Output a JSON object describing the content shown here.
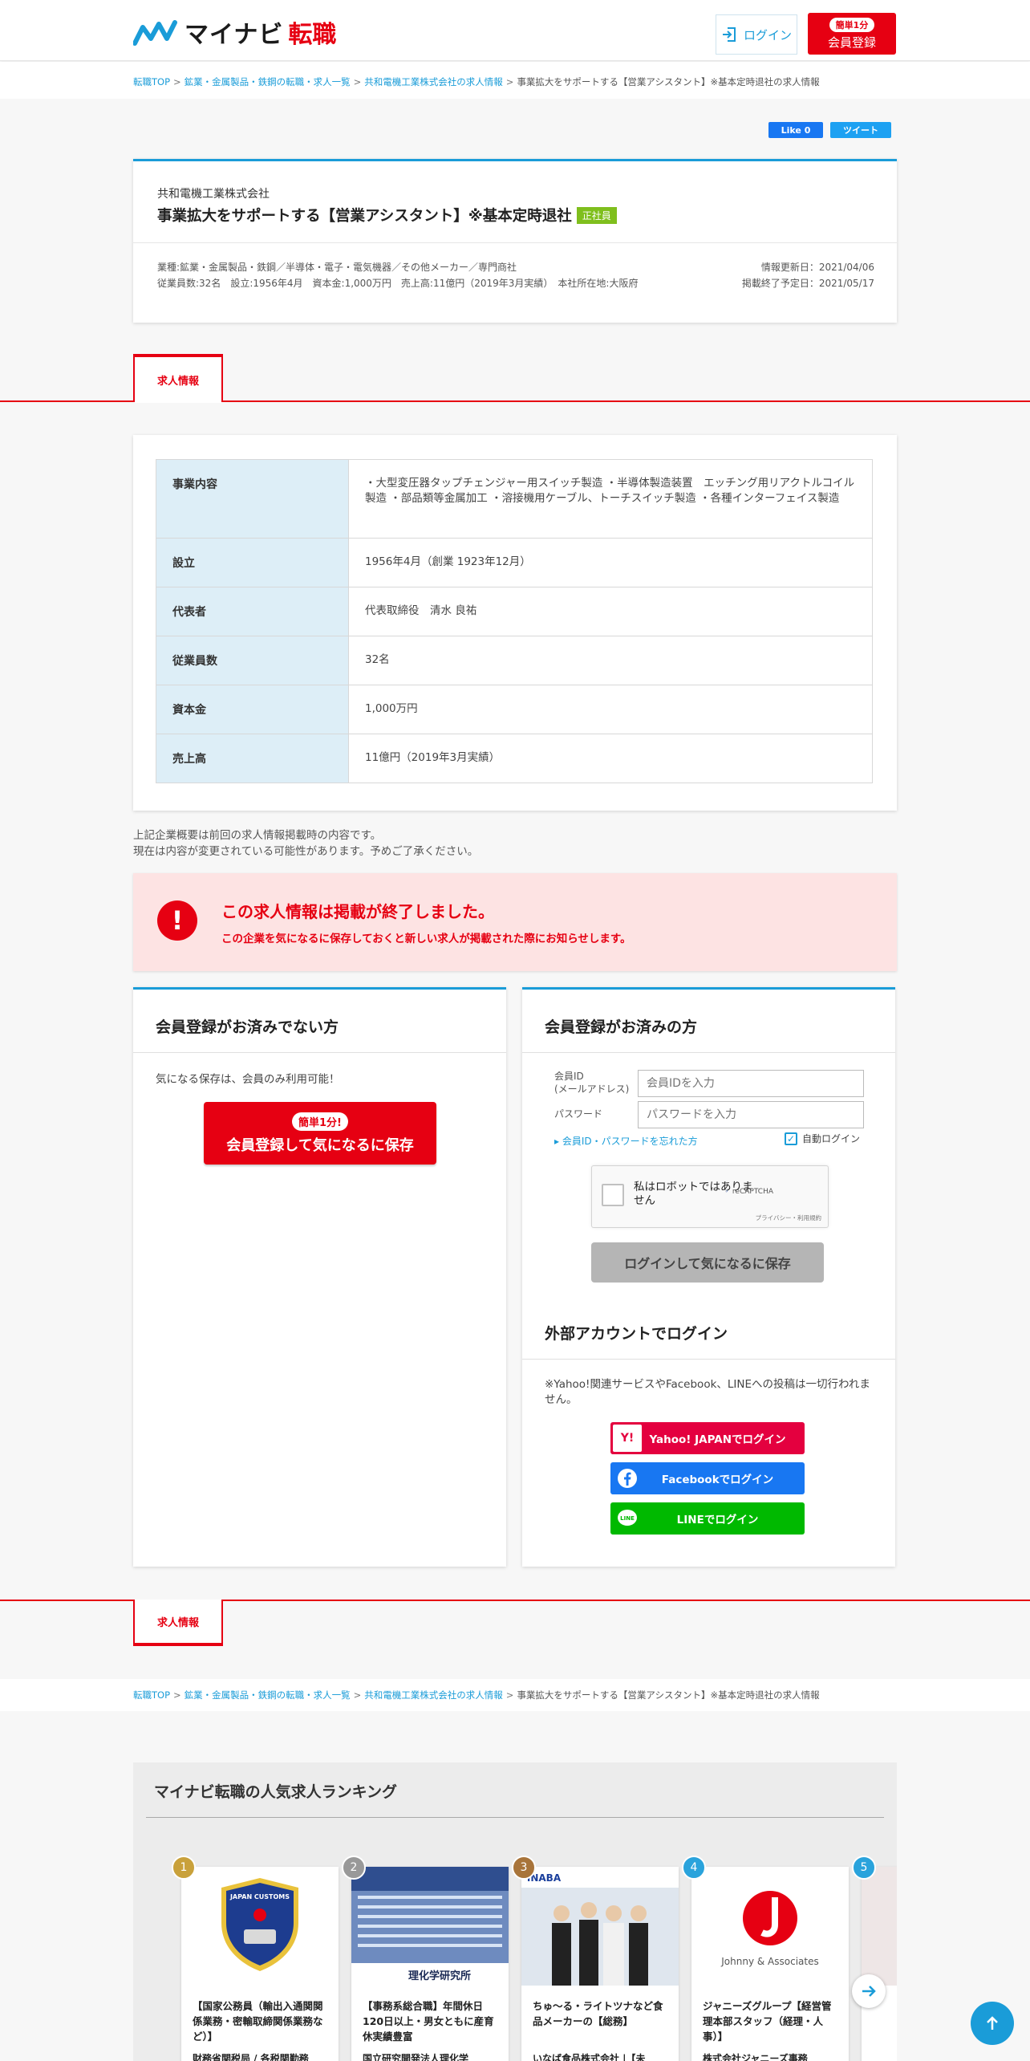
{
  "header": {
    "logo_text": "マイナビ",
    "logo_sub": "転職",
    "login_label": "ログイン",
    "register_pill": "簡単1分",
    "register_label": "会員登録"
  },
  "breadcrumb": {
    "items": [
      "転職TOP",
      "鉱業・金属製品・鉄鋼の転職・求人一覧",
      "共和電機工業株式会社の求人情報"
    ],
    "current": "事業拡大をサポートする【営業アシスタント】※基本定時退社の求人情報",
    "sep": ">"
  },
  "social": {
    "like": "Like 0",
    "tweet": "ツイート"
  },
  "job": {
    "company": "共和電機工業株式会社",
    "title": "事業拡大をサポートする【営業アシスタント】※基本定時退社",
    "badge": "正社員",
    "meta_line1": "業種:鉱業・金属製品・鉄鋼／半導体・電子・電気機器／その他メーカー／専門商社",
    "meta_line2": "従業員数:32名　設立:1956年4月　資本金:1,000万円　売上高:11億円（2019年3月実績）　本社所在地:大阪府",
    "updated": "情報更新日：2021/04/06",
    "end_date": "掲載終了予定日：2021/05/17"
  },
  "tab_label": "求人情報",
  "info_table": [
    {
      "label": "事業内容",
      "value": "・大型変圧器タップチェンジャー用スイッチ製造 ・半導体製造装置　エッチング用リアクトルコイル製造 ・部品類等金属加工 ・溶接機用ケーブル、トーチスイッチ製造 ・各種インターフェイス製造"
    },
    {
      "label": "設立",
      "value": "1956年4月（創業 1923年12月）"
    },
    {
      "label": "代表者",
      "value": "代表取締役　清水 良祐"
    },
    {
      "label": "従業員数",
      "value": "32名"
    },
    {
      "label": "資本金",
      "value": "1,000万円"
    },
    {
      "label": "売上高",
      "value": "11億円（2019年3月実績）"
    }
  ],
  "note": {
    "line1": "上記企業概要は前回の求人情報掲載時の内容です。",
    "line2": "現在は内容が変更されている可能性があります。予めご了承ください。"
  },
  "alert": {
    "icon": "!",
    "title": "この求人情報は掲載が終了しました。",
    "text": "この企業を気になるに保存しておくと新しい求人が掲載された際にお知らせします。"
  },
  "panel_guest": {
    "title": "会員登録がお済みでない方",
    "text": "気になる保存は、会員のみ利用可能！",
    "btn_pill": "簡単1分!",
    "btn_label": "会員登録して気になるに保存"
  },
  "panel_member": {
    "title": "会員登録がお済みの方",
    "id_label_1": "会員ID",
    "id_label_2": "(メールアドレス)",
    "id_placeholder": "会員IDを入力",
    "pw_label": "パスワード",
    "pw_placeholder": "パスワードを入力",
    "forgot": "会員ID・パスワードを忘れた方",
    "auto_login": "自動ログイン",
    "captcha_text": "私はロボットではありません",
    "captcha_brand": "reCAPTCHA",
    "captcha_links": "プライバシー・利用規約",
    "save_btn": "ログインして気になるに保存",
    "ext_title": "外部アカウントでログイン",
    "ext_note": "※Yahoo!関連サービスやFacebook、LINEへの投稿は一切行われません。",
    "yahoo": "Yahoo! JAPANでログイン",
    "facebook": "Facebookでログイン",
    "line": "LINEでログイン"
  },
  "ranking": {
    "title": "マイナビ転職の人気求人ランキング",
    "cards": [
      {
        "num": "1",
        "color": "#c9a13b",
        "title": "【国家公務員（輸出入通関関係業務・密輸取締関係業務など）】",
        "company": "財務省関税局 / 各税関勤務"
      },
      {
        "num": "2",
        "color": "#999999",
        "title": "【事務系総合職】年間休日120日以上・男女ともに産育休実績豊富",
        "company": "国立研究開発法人理化学"
      },
      {
        "num": "3",
        "color": "#a8743a",
        "title": "ちゅ～る・ライトツナなど食品メーカーの【総務】",
        "company": "いなば食品株式会社 |【未"
      },
      {
        "num": "4",
        "color": "#2aa3dc",
        "title": "ジャニーズグループ【経営管理本部スタッフ（経理・人事）】",
        "company": "株式会社ジャニーズ事務"
      },
      {
        "num": "5",
        "color": "#2aa3dc",
        "title": "",
        "company": ""
      }
    ],
    "logo_riken": "理化学研究所",
    "logo_johnny": "Johnny & Associates",
    "logo_customs": "JAPAN CUSTOMS",
    "logo_inaba": "INABA"
  }
}
